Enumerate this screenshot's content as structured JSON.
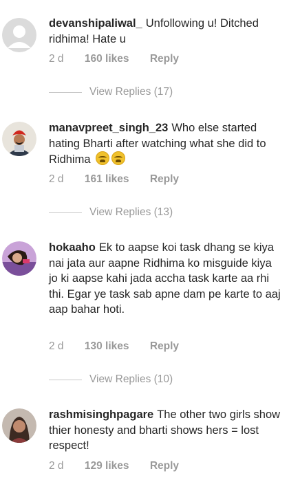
{
  "comments": [
    {
      "username": "devanshipaliwal_",
      "text": "Unfollowing u! Ditched ridhima! Hate u",
      "time": "2 d",
      "likes": "160 likes",
      "reply": "Reply",
      "view_replies": "View Replies (17)",
      "avatar": "default-avatar-icon"
    },
    {
      "username": "manavpreet_singh_23",
      "text": "Who else started hating Bharti after watching what she did to Ridhima",
      "emojis": [
        "weary-face-emoji",
        "weary-face-emoji"
      ],
      "time": "2 d",
      "likes": "161 likes",
      "reply": "Reply",
      "view_replies": "View Replies (13)",
      "avatar": "user-photo"
    },
    {
      "username": "hokaaho",
      "text": "Ek to aapse koi task dhang se kiya nai jata aur aapne Ridhima ko misguide kiya jo ki aapse kahi jada accha task karte aa rhi thi. Egar ye task sab apne dam pe karte to aaj aap bahar hoti.",
      "time": "2 d",
      "likes": "130 likes",
      "reply": "Reply",
      "view_replies": "View Replies (10)",
      "avatar": "user-photo"
    },
    {
      "username": "rashmisinghpagare",
      "text": "The other two girls show thier honesty and bharti shows hers = lost respect!",
      "time": "2 d",
      "likes": "129 likes",
      "reply": "Reply",
      "avatar": "user-photo"
    }
  ]
}
